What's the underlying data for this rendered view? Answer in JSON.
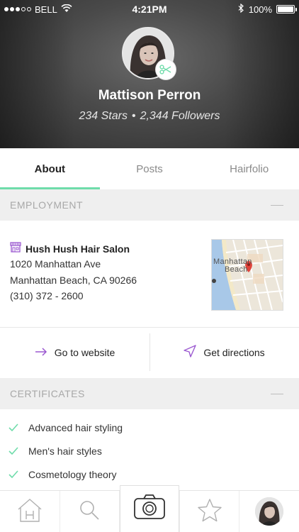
{
  "status_bar": {
    "carrier": "BELL",
    "time": "4:21PM",
    "battery": "100%",
    "battery_level": 1.0
  },
  "profile": {
    "name": "Mattison Perron",
    "stars": "234 Stars",
    "separator": "•",
    "followers": "2,344 Followers"
  },
  "tabs": [
    {
      "label": "About",
      "active": true
    },
    {
      "label": "Posts",
      "active": false
    },
    {
      "label": "Hairfolio",
      "active": false
    }
  ],
  "employment": {
    "section_title": "EMPLOYMENT",
    "salon_name": "Hush Hush Hair Salon",
    "address_line1": "1020 Manhattan Ave",
    "address_line2": "Manhattan Beach, CA 90266",
    "phone": "(310) 372 - 2600",
    "map": {
      "label_line1": "Manhattan",
      "label_line2": "Beach"
    }
  },
  "actions": {
    "website_label": "Go to website",
    "directions_label": "Get directions"
  },
  "certificates": {
    "section_title": "CERTIFICATES",
    "items": [
      "Advanced hair styling",
      "Men's hair styles",
      "Cosmetology theory"
    ]
  },
  "tab_bar": {
    "items": [
      "home-icon",
      "search-icon",
      "camera-icon",
      "star-icon",
      "profile-avatar"
    ]
  },
  "colors": {
    "accent_green": "#6fdcaa",
    "purple": "#9b59d0",
    "map_pin": "#e0443b"
  }
}
